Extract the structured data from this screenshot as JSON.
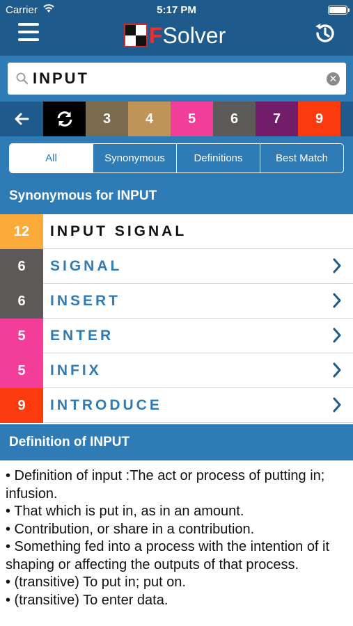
{
  "status": {
    "carrier": "Carrier",
    "time": "5:17 PM"
  },
  "nav": {
    "brand_first": "F",
    "brand_rest": "Solver"
  },
  "search": {
    "value": "INPUT"
  },
  "length_filters": [
    {
      "label": "3",
      "color": "#7a6a4e"
    },
    {
      "label": "4",
      "color": "#c09458"
    },
    {
      "label": "5",
      "color": "#f23d99"
    },
    {
      "label": "6",
      "color": "#5c5a58"
    },
    {
      "label": "7",
      "color": "#721c6a"
    },
    {
      "label": "9",
      "color": "#fb3b0e"
    }
  ],
  "tabs": [
    {
      "label": "All",
      "active": true
    },
    {
      "label": "Synonymous",
      "active": false
    },
    {
      "label": "Definitions",
      "active": false
    },
    {
      "label": "Best Match",
      "active": false
    }
  ],
  "synonyms_title": "Synonymous for INPUT",
  "results": [
    {
      "count": "12",
      "word": "INPUT SIGNAL",
      "color": "#fbab3a",
      "exact": true
    },
    {
      "count": "6",
      "word": "SIGNAL",
      "color": "#5c5a58",
      "exact": false
    },
    {
      "count": "6",
      "word": "INSERT",
      "color": "#5c5a58",
      "exact": false
    },
    {
      "count": "5",
      "word": "ENTER",
      "color": "#f23d99",
      "exact": false
    },
    {
      "count": "5",
      "word": "INFIX",
      "color": "#f23d99",
      "exact": false
    },
    {
      "count": "9",
      "word": "INTRODUCE",
      "color": "#fb3b0e",
      "exact": false
    }
  ],
  "definition_title": "Definition of INPUT",
  "definitions": [
    "• Definition of input :The act or process of putting in; infusion.",
    "• That which is put in, as in an amount.",
    "• Contribution, or share in a contribution.",
    "• Something fed into a process with the intention of it shaping or affecting the outputs of that process.",
    "• (transitive) To put in; put on.",
    "• (transitive) To enter data."
  ],
  "colors": {
    "nav": "#1e5a8c",
    "accent": "#2e7bb6"
  }
}
